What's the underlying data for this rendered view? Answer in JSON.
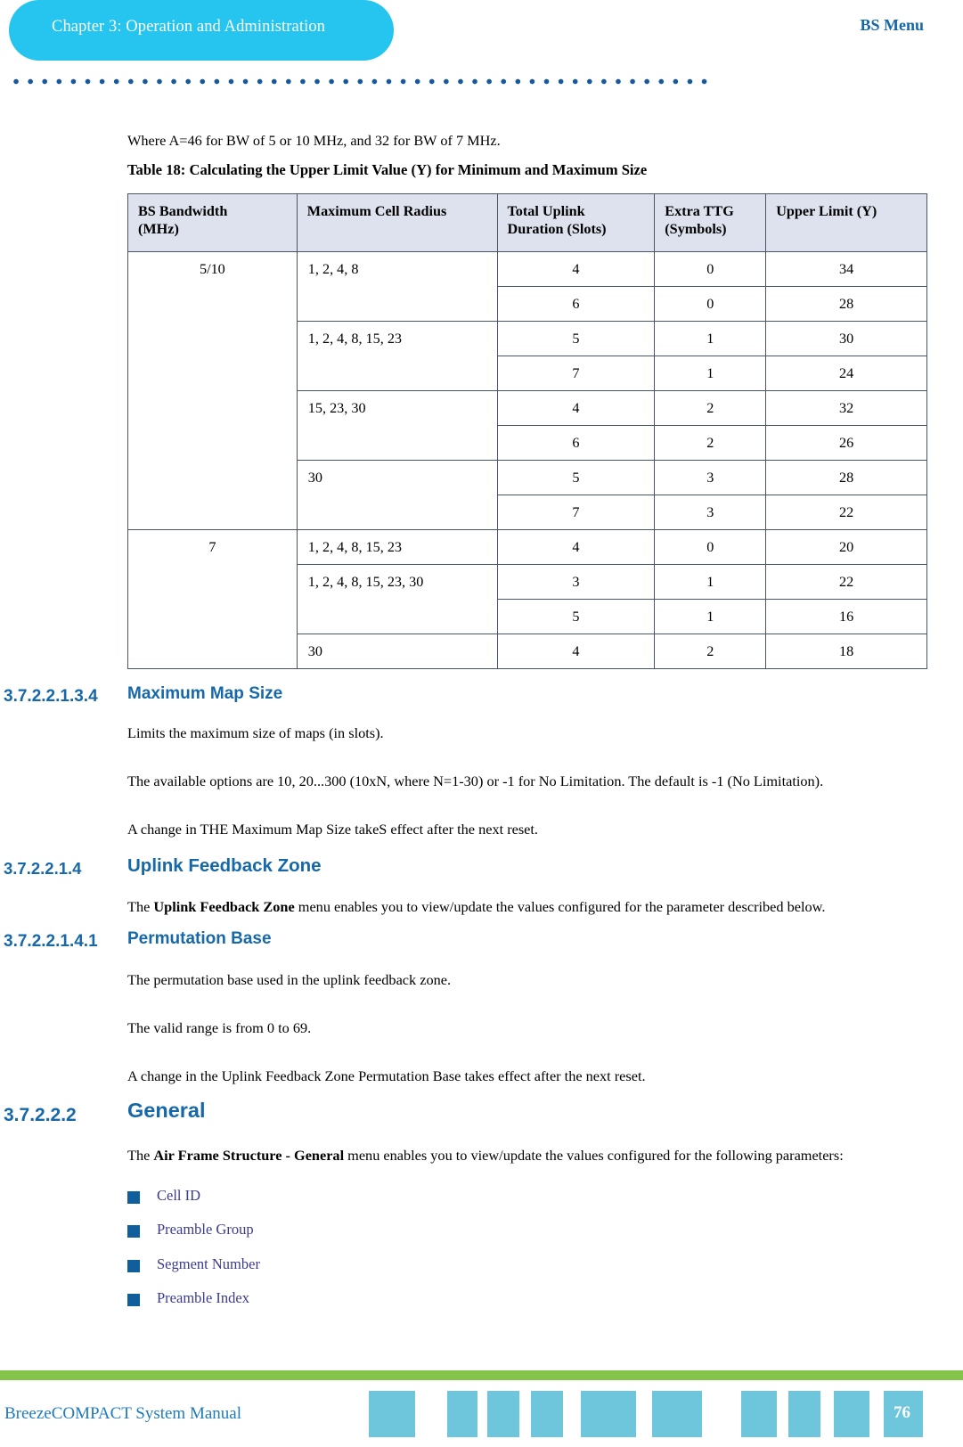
{
  "header": {
    "chapter_label": "Chapter 3: Operation and Administration",
    "right_title": "BS Menu",
    "pill_color": "#25c5ef",
    "accent_color": "#1668a8"
  },
  "intro": {
    "where_line": "Where A=46 for BW of 5 or 10 MHz, and 32 for BW of 7 MHz.",
    "table_caption": "Table 18: Calculating the Upper Limit Value (Y) for Minimum and Maximum Size"
  },
  "table": {
    "columns": [
      "BS Bandwidth (MHz)",
      "Maximum Cell Radius",
      "Total Uplink Duration (Slots)",
      "Extra TTG (Symbols)",
      "Upper Limit (Y)"
    ],
    "column_lines": [
      [
        "BS Bandwidth",
        "(MHz)"
      ],
      [
        "Maximum Cell Radius",
        ""
      ],
      [
        "Total Uplink",
        "Duration (Slots)"
      ],
      [
        "Extra TTG",
        "(Symbols)"
      ],
      [
        "Upper Limit (Y)",
        ""
      ]
    ],
    "groups": [
      {
        "bandwidth": "5/10",
        "radius_groups": [
          {
            "radius": "1, 2, 4, 8",
            "rows": [
              {
                "uplink": "4",
                "ttg": "0",
                "upper": "34"
              },
              {
                "uplink": "6",
                "ttg": "0",
                "upper": "28"
              }
            ]
          },
          {
            "radius": "1, 2, 4, 8, 15, 23",
            "rows": [
              {
                "uplink": "5",
                "ttg": "1",
                "upper": "30"
              },
              {
                "uplink": "7",
                "ttg": "1",
                "upper": "24"
              }
            ]
          },
          {
            "radius": "15, 23, 30",
            "rows": [
              {
                "uplink": "4",
                "ttg": "2",
                "upper": "32"
              },
              {
                "uplink": "6",
                "ttg": "2",
                "upper": "26"
              }
            ]
          },
          {
            "radius": "30",
            "rows": [
              {
                "uplink": "5",
                "ttg": "3",
                "upper": "28"
              },
              {
                "uplink": "7",
                "ttg": "3",
                "upper": "22"
              }
            ]
          }
        ]
      },
      {
        "bandwidth": "7",
        "radius_groups": [
          {
            "radius": "1, 2, 4, 8, 15, 23",
            "rows": [
              {
                "uplink": "4",
                "ttg": "0",
                "upper": "20"
              }
            ]
          },
          {
            "radius": "1, 2, 4, 8, 15, 23, 30",
            "rows": [
              {
                "uplink": "3",
                "ttg": "1",
                "upper": "22"
              },
              {
                "uplink": "5",
                "ttg": "1",
                "upper": "16"
              }
            ]
          },
          {
            "radius": "30",
            "rows": [
              {
                "uplink": "4",
                "ttg": "2",
                "upper": "18"
              }
            ]
          }
        ]
      }
    ]
  },
  "sections": [
    {
      "number": "3.7.2.2.1.3.4",
      "title": "Maximum Map Size",
      "paragraphs": [
        "Limits the maximum size of maps (in slots).",
        "The available options are 10, 20...300 (10xN, where N=1-30) or -1 for No Limitation. The default is -1 (No Limitation).",
        "A change in THE Maximum Map Size takeS effect after the next reset."
      ]
    },
    {
      "number": "3.7.2.2.1.4",
      "title": "Uplink Feedback Zone",
      "paragraph_rich": {
        "pre": "The ",
        "bold": "Uplink Feedback Zone",
        "post": " menu enables you to view/update the values configured for the parameter described below."
      }
    },
    {
      "number": "3.7.2.2.1.4.1",
      "title": "Permutation Base",
      "paragraphs": [
        "The permutation base used in the uplink feedback zone.",
        "The valid range is from 0 to 69.",
        "A change in the Uplink Feedback Zone Permutation Base takes effect after the next reset."
      ]
    },
    {
      "number": "3.7.2.2.2",
      "title": "General",
      "paragraph_rich": {
        "pre": "The ",
        "bold": "Air Frame Structure - General",
        "post": " menu enables you to view/update the values configured for the following parameters:"
      },
      "bullets": [
        "Cell ID",
        "Preamble Group",
        "Segment Number",
        "Preamble Index"
      ]
    }
  ],
  "footer": {
    "manual_title": "BreezeCOMPACT System Manual",
    "page_number": "76",
    "green_bar_color": "#85c44a",
    "block_color": "#6ec6dc"
  }
}
